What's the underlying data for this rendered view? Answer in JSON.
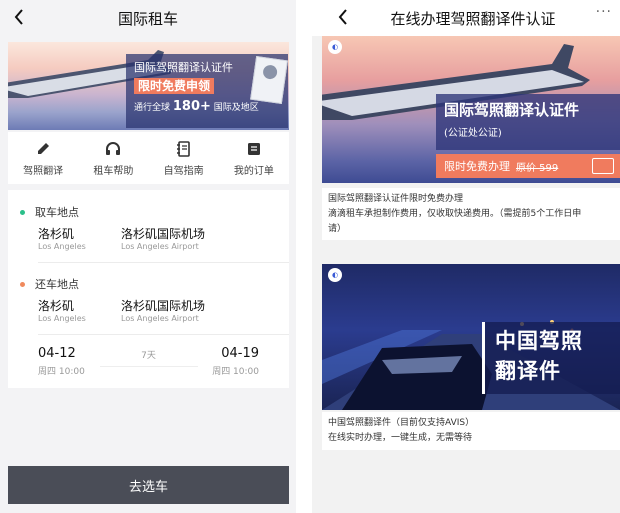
{
  "left": {
    "title": "国际租车",
    "banner": {
      "line1": "国际驾照翻译认证件",
      "line2": "限时免费申领",
      "line3_pre": "通行全球",
      "line3_num": "180+",
      "line3_post": "国际及地区"
    },
    "menu": [
      {
        "label": "驾照翻译",
        "icon": "pencil-icon"
      },
      {
        "label": "租车帮助",
        "icon": "headset-icon"
      },
      {
        "label": "自驾指南",
        "icon": "notebook-icon"
      },
      {
        "label": "我的订单",
        "icon": "receipt-icon"
      }
    ],
    "pickup": {
      "title": "取车地点",
      "city_cn": "洛杉矶",
      "city_en": "Los Angeles",
      "place_cn": "洛杉矶国际机场",
      "place_en": "Los Angeles Airport",
      "dot_color": "#2bbf8a"
    },
    "dropoff": {
      "title": "还车地点",
      "city_cn": "洛杉矶",
      "city_en": "Los Angeles",
      "place_cn": "洛杉矶国际机场",
      "place_en": "Los Angeles Airport",
      "dot_color": "#f08a5d"
    },
    "dates": {
      "start_date": "04-12",
      "start_time": "周四 10:00",
      "end_date": "04-19",
      "end_time": "周四 10:00",
      "duration": "7天"
    },
    "button": "去选车"
  },
  "right": {
    "title": "在线办理驾照翻译件认证",
    "more": "···",
    "banner1": {
      "title": "国际驾照翻译认证件",
      "subtitle": "(公证处公证)",
      "tag": "限时免费办理",
      "old_price": "原价 599"
    },
    "text1": {
      "line1": "国际驾照翻译认证件限时免费办理",
      "line2": "滴滴租车承担制作费用，仅收取快递费用。（需提前5个工作日申",
      "line3": "请）"
    },
    "banner2": {
      "title_line1": "中国驾照",
      "title_line2": "翻译件"
    },
    "text2": {
      "line1": "中国驾照翻译件（目前仅支持AVIS）",
      "line2": "在线实时办理，一键生成，无需等待"
    }
  },
  "colors": {
    "button_bg": "#4a4d57",
    "accent_orange": "#f07b5e",
    "banner_navy": "#2d3478"
  }
}
